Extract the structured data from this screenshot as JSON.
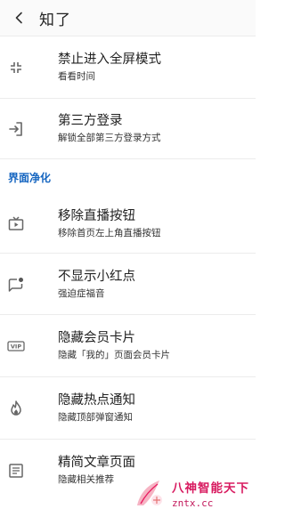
{
  "header": {
    "title": "知了",
    "back_icon": "chevron-left-icon"
  },
  "top_items": [
    {
      "title": "禁止进入全屏模式",
      "subtitle": "看看时间",
      "icon": "fullscreen-exit-icon"
    },
    {
      "title": "第三方登录",
      "subtitle": "解锁全部第三方登录方式",
      "icon": "login-icon"
    }
  ],
  "section": {
    "title": "界面净化",
    "color": "#1565c0"
  },
  "items": [
    {
      "title": "移除直播按钮",
      "subtitle": "移除首页左上角直播按钮",
      "icon": "live-tv-icon"
    },
    {
      "title": "不显示小红点",
      "subtitle": "强迫症福音",
      "icon": "chat-badge-icon"
    },
    {
      "title": "隐藏会员卡片",
      "subtitle": "隐藏「我的」页面会员卡片",
      "icon": "vip-icon"
    },
    {
      "title": "隐藏热点通知",
      "subtitle": "隐藏顶部弹窗通知",
      "icon": "fire-icon"
    },
    {
      "title": "精简文章页面",
      "subtitle": "隐藏相关推荐",
      "icon": "article-icon"
    }
  ],
  "watermark": {
    "name": "八神智能天下",
    "url": "zntx.cc"
  }
}
